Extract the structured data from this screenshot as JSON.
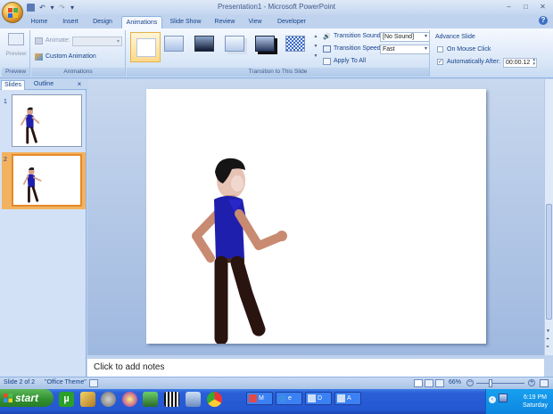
{
  "window": {
    "title": "Presentation1 - Microsoft PowerPoint"
  },
  "tabs": [
    "Home",
    "Insert",
    "Design",
    "Animations",
    "Slide Show",
    "Review",
    "View",
    "Developer"
  ],
  "active_tab": "Animations",
  "ribbon": {
    "preview": {
      "button_label": "Preview",
      "group_label": "Preview"
    },
    "animations": {
      "animate_label": "Animate:",
      "custom_animation_label": "Custom Animation",
      "group_label": "Animations"
    },
    "transition": {
      "sound_label": "Transition Sound:",
      "sound_value": "[No Sound]",
      "speed_label": "Transition Speed:",
      "speed_value": "Fast",
      "apply_all_label": "Apply To All",
      "group_label": "Transition to This Slide"
    },
    "advance": {
      "heading": "Advance Slide",
      "on_mouse_click_label": "On Mouse Click",
      "on_mouse_click_checked": false,
      "auto_after_label": "Automatically After:",
      "auto_after_checked": true,
      "auto_after_value": "00:00.12"
    }
  },
  "pane": {
    "tabs": [
      "Slides",
      "Outline"
    ],
    "close_glyph": "×",
    "slide_numbers": [
      "1",
      "2"
    ],
    "selected_slide": 2
  },
  "notes_placeholder": "Click to add notes",
  "status": {
    "slide_info": "Slide 2 of 2",
    "theme": "\"Office Theme\"",
    "zoom": "66%"
  },
  "taskbar": {
    "start_label": "start",
    "tasks": [
      {
        "label": "M",
        "color": "#e24a4a"
      },
      {
        "label": "e",
        "color": "#3a8ee6"
      },
      {
        "label": "D",
        "color": "#3a8ee6"
      },
      {
        "label": "A",
        "color": "#3a8ee6"
      }
    ],
    "clock_time": "6:19 PM",
    "clock_day": "Saturday"
  },
  "colors": {
    "ribbon_accent": "#15428b",
    "shirt": "#1f1fae",
    "pants": "#2a1410",
    "skin": "#d8a28a",
    "hair": "#151515",
    "selected_thumb_border": "#e38a2a"
  }
}
